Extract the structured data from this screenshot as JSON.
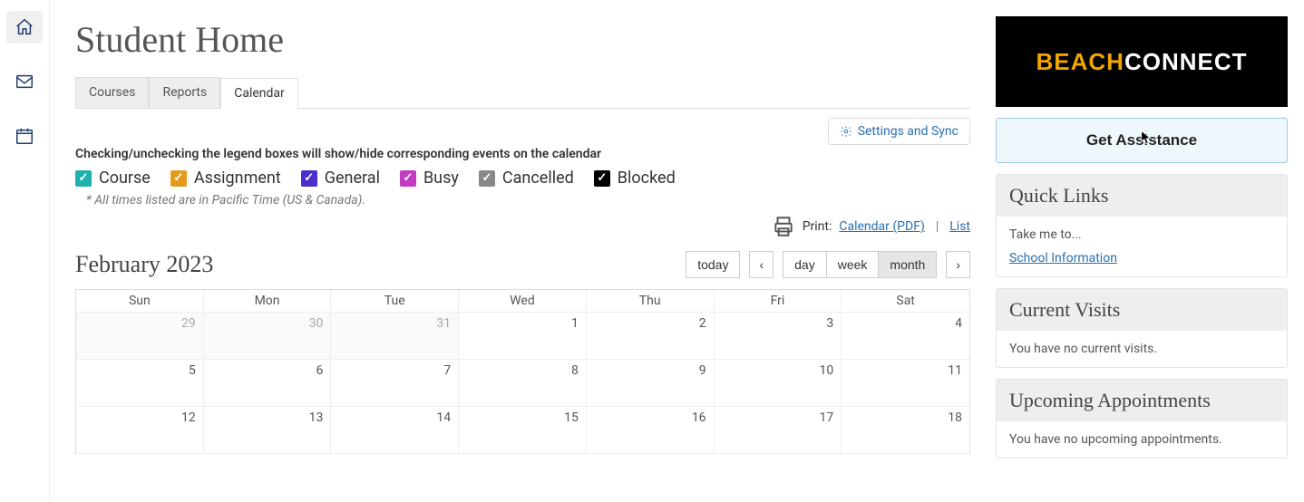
{
  "rail": {
    "items": [
      {
        "name": "home-icon"
      },
      {
        "name": "mail-icon"
      },
      {
        "name": "calendar-icon"
      }
    ]
  },
  "header": {
    "title": "Student Home"
  },
  "tabs": [
    {
      "label": "Courses",
      "active": false
    },
    {
      "label": "Reports",
      "active": false
    },
    {
      "label": "Calendar",
      "active": true
    }
  ],
  "settings_sync_label": "Settings and Sync",
  "legend_note": "Checking/unchecking the legend boxes will show/hide corresponding events on the calendar",
  "legend": [
    {
      "label": "Course",
      "color": "#20b2aa"
    },
    {
      "label": "Assignment",
      "color": "#e39b1e"
    },
    {
      "label": "General",
      "color": "#4b2fcc"
    },
    {
      "label": "Busy",
      "color": "#c23bc2"
    },
    {
      "label": "Cancelled",
      "color": "#888888"
    },
    {
      "label": "Blocked",
      "color": "#000000"
    }
  ],
  "tz_note": "* All times listed are in Pacific Time (US & Canada).",
  "print": {
    "label": "Print:",
    "pdf": "Calendar (PDF)",
    "list": "List"
  },
  "calendar": {
    "title": "February 2023",
    "today_label": "today",
    "views": {
      "day": "day",
      "week": "week",
      "month": "month",
      "active": "month"
    },
    "dow": [
      "Sun",
      "Mon",
      "Tue",
      "Wed",
      "Thu",
      "Fri",
      "Sat"
    ],
    "weeks": [
      [
        {
          "n": 29,
          "other": true
        },
        {
          "n": 30,
          "other": true
        },
        {
          "n": 31,
          "other": true
        },
        {
          "n": 1
        },
        {
          "n": 2
        },
        {
          "n": 3
        },
        {
          "n": 4
        }
      ],
      [
        {
          "n": 5
        },
        {
          "n": 6
        },
        {
          "n": 7
        },
        {
          "n": 8
        },
        {
          "n": 9
        },
        {
          "n": 10
        },
        {
          "n": 11
        }
      ],
      [
        {
          "n": 12
        },
        {
          "n": 13
        },
        {
          "n": 14
        },
        {
          "n": 15
        },
        {
          "n": 16
        },
        {
          "n": 17
        },
        {
          "n": 18
        }
      ]
    ]
  },
  "sidebar": {
    "brand": {
      "part1": "BEACH",
      "part2": "CONNECT"
    },
    "assist_label": "Get Assistance",
    "quick_links": {
      "title": "Quick Links",
      "sub": "Take me to...",
      "link": "School Information"
    },
    "visits": {
      "title": "Current Visits",
      "body": "You have no current visits."
    },
    "appointments": {
      "title": "Upcoming Appointments",
      "body": "You have no upcoming appointments."
    }
  }
}
